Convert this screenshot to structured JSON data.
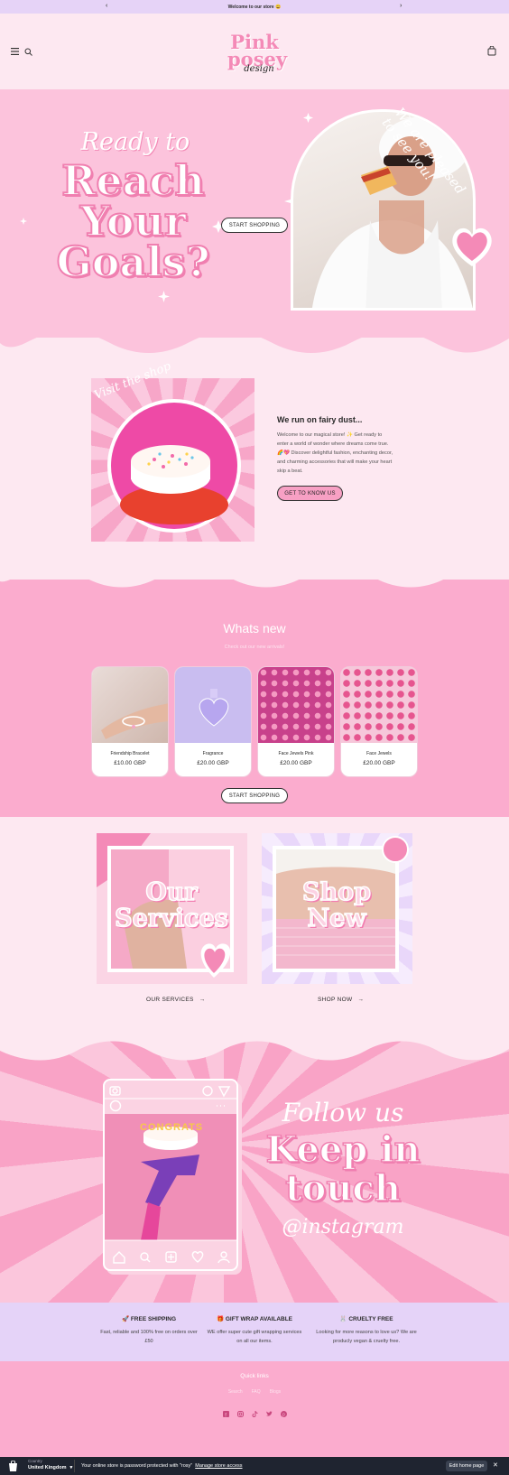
{
  "announcement": {
    "text": "Welcome to our store 😄",
    "prev": "‹",
    "next": "›"
  },
  "header": {
    "logo_line1": "Pink",
    "logo_line2": "posey",
    "logo_line3": "design",
    "icons": [
      "menu-icon",
      "search-icon",
      "cart-icon"
    ]
  },
  "hero": {
    "script": "Ready to",
    "line1": "Reach",
    "line2": "Your",
    "line3": "Goals?",
    "button": "START SHOPPING",
    "arc_text": "We are pleased to see you!"
  },
  "about": {
    "badge": "Visit the shop",
    "title": "We run on fairy dust...",
    "body": "Welcome to our magical store! ✨ Get ready to enter a world of wonder where dreams come true. 🌈💖 Discover delightful fashion, enchanting decor, and charming accessories that will make your heart skip a beat.",
    "button": "GET TO KNOW US"
  },
  "whats_new": {
    "title": "Whats new",
    "subtitle": "Check out our new arrivals!",
    "products": [
      {
        "name": "Friendship Bracelet",
        "price": "£10.00 GBP"
      },
      {
        "name": "Fragrance",
        "price": "£20.00 GBP"
      },
      {
        "name": "Face Jewels Pink",
        "price": "£20.00 GBP"
      },
      {
        "name": "Face Jewels",
        "price": "£20.00 GBP"
      }
    ],
    "button": "START SHOPPING"
  },
  "services": {
    "left_word1": "Our",
    "left_word2": "Services",
    "left_label": "OUR SERVICES",
    "right_word1": "Shop",
    "right_word2": "New",
    "right_label": "SHOP NOW",
    "arrow": "→"
  },
  "follow": {
    "script": "Follow us",
    "line1": "Keep in",
    "line2": "touch",
    "handle": "@instagram",
    "cake_text": "CONGRATS"
  },
  "features": [
    {
      "title": "🚀 FREE SHIPPING",
      "body": "Fast, reliable and 100% free on orders over £50"
    },
    {
      "title": "🎁 GIFT WRAP AVAILABLE",
      "body": "WE offer super cute gift wrapping services on all our items."
    },
    {
      "title": "🐰 CRUELTY FREE",
      "body": "Looking for more reasons to love us? We are producly vegan & cruelty free."
    }
  ],
  "footer": {
    "quick_links": "Quick links",
    "links": [
      "Search",
      "FAQ",
      "Blogs"
    ],
    "social": [
      "facebook-icon",
      "instagram-icon",
      "tiktok-icon",
      "twitter-icon",
      "pinterest-icon"
    ]
  },
  "admin_bar": {
    "country_label": "Country",
    "country_value": "United Kingdom",
    "message": "Your online store is password protected with \"rosy\"",
    "manage_link": "Manage store access",
    "edit_button": "Edit home page",
    "close": "✕"
  },
  "colors": {
    "accent_pink": "#f48ab7",
    "soft_pink": "#fde8f1",
    "lavender": "#e6d3f7",
    "dark": "#1f2430"
  }
}
